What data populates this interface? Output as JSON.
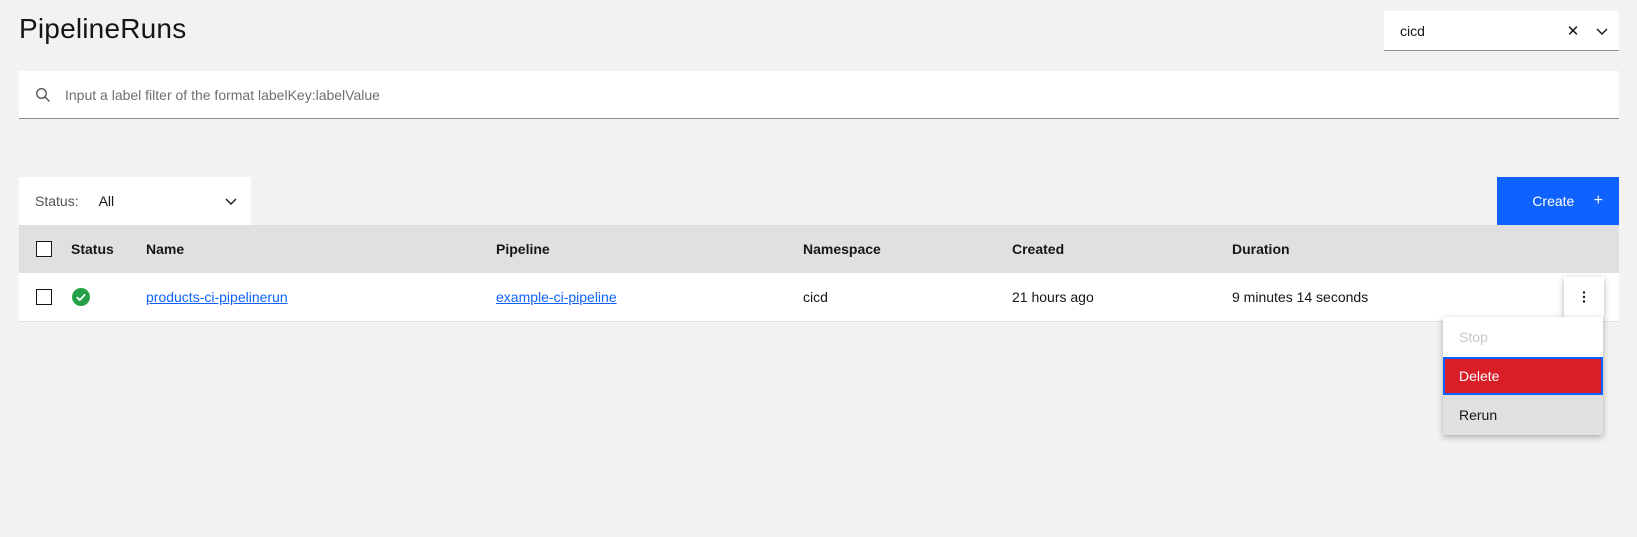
{
  "page": {
    "title": "PipelineRuns"
  },
  "namespace_select": {
    "value": "cicd",
    "clear_icon": "close-icon",
    "toggle_icon": "chevron-down-icon"
  },
  "search": {
    "placeholder": "Input a label filter of the format labelKey:labelValue",
    "value": ""
  },
  "toolbar": {
    "status_label": "Status:",
    "status_value": "All",
    "create_label": "Create",
    "create_icon": "+"
  },
  "table": {
    "headers": {
      "status": "Status",
      "name": "Name",
      "pipeline": "Pipeline",
      "namespace": "Namespace",
      "created": "Created",
      "duration": "Duration"
    },
    "rows": [
      {
        "status": "succeeded",
        "name": "products-ci-pipelinerun",
        "pipeline": "example-ci-pipeline",
        "namespace": "cicd",
        "created": "21 hours ago",
        "duration": "9 minutes 14 seconds"
      }
    ]
  },
  "overflow_menu": {
    "items": [
      {
        "label": "Stop",
        "state": "disabled"
      },
      {
        "label": "Delete",
        "state": "danger-focused"
      },
      {
        "label": "Rerun",
        "state": "normal"
      }
    ]
  },
  "colors": {
    "primary": "#0f62fe",
    "danger": "#da1e28",
    "success": "#24a148",
    "background": "#f2f2f2"
  }
}
